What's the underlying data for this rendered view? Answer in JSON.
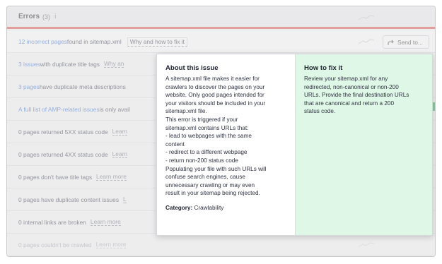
{
  "header": {
    "title": "Errors",
    "count": "(3)",
    "info_glyph": "i"
  },
  "rows": [
    {
      "link": "12 incorrect pages",
      "text": " found in sitemap.xml",
      "learn": "Why and how to fix it"
    },
    {
      "link": "3 issues",
      "text": " with duplicate title tags",
      "learn": "Why an"
    },
    {
      "link": "3 pages",
      "text": " have duplicate meta descriptions",
      "learn": ""
    },
    {
      "link": "A full list of AMP-related issues",
      "text": " is only avail",
      "learn": ""
    },
    {
      "link": "",
      "text": "0 pages returned 5XX status code",
      "learn": "Learn"
    },
    {
      "link": "",
      "text": "0 pages returned 4XX status code",
      "learn": "Learn"
    },
    {
      "link": "",
      "text": "0 pages don't have title tags",
      "learn": "Learn more"
    },
    {
      "link": "",
      "text": "0 pages have duplicate content issues",
      "learn": "L"
    },
    {
      "link": "",
      "text": "0 internal links are broken",
      "learn": "Learn more"
    },
    {
      "link": "",
      "text": "0 pages couldn't be crawled",
      "learn": "Learn more"
    }
  ],
  "send_button": {
    "label": "Send to..."
  },
  "popover": {
    "about_title": "About this issue",
    "about_lines": [
      "A sitemap.xml file makes it easier for",
      "crawlers to discover the pages on your",
      "website. Only good pages intended for",
      "your visitors should be included in your",
      "sitemap.xml file.",
      "This error is triggered if your",
      "sitemap.xml contains URLs that:",
      "- lead to webpages with the same",
      "content",
      "- redirect to a different webpage",
      "- return non-200 status code",
      "Populating your file with such URLs will",
      "confuse search engines, cause",
      "unnecessary crawling or may even",
      "result in your sitemap being rejected."
    ],
    "category_label": "Category:",
    "category_value": " Crawlability",
    "fix_title": "How to fix it",
    "fix_lines": [
      "Review your sitemap.xml for any",
      "redirected, non-canonical or non-200",
      "URLs. Provide the final destination URLs",
      "that are canonical and return a 200",
      "status code."
    ]
  },
  "icons": {
    "info": "info-icon",
    "share": "share-arrow-icon",
    "sparkline": "sparkline-icon"
  },
  "colors": {
    "error_red": "#e0483f",
    "link_blue": "#2d6bd8",
    "fix_bg": "#dff7e6"
  }
}
